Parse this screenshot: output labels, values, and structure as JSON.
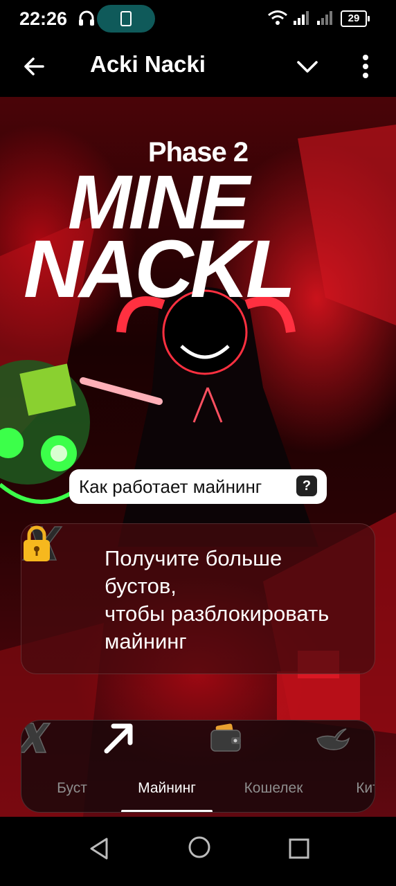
{
  "status_bar": {
    "time": "22:26",
    "battery_level": "29",
    "icons": [
      "headset-icon",
      "phone-icon",
      "wifi-icon",
      "signal-icon",
      "signal-icon",
      "battery-icon"
    ]
  },
  "app_bar": {
    "title": "Acki Nacki",
    "back_icon": "arrow-left-icon",
    "collapse_icon": "chevron-down-icon",
    "menu_icon": "more-vertical-icon"
  },
  "hero": {
    "phase": "Phase 2",
    "title_line_1": "MINE",
    "title_line_2": "NACKL"
  },
  "how_it_works": {
    "label": "Как работает майнинг",
    "help_glyph": "?"
  },
  "lock_card": {
    "message_lines": [
      "Получите больше",
      "бустов,",
      "чтобы разблокировать",
      "майнинг"
    ],
    "icons": [
      "x-logo-icon",
      "lock-icon"
    ]
  },
  "bottom_nav": {
    "active_index": 1,
    "items": [
      {
        "label": "Буст",
        "icon": "x-logo-icon"
      },
      {
        "label": "Майнинг",
        "icon": "arrow-up-right-icon"
      },
      {
        "label": "Кошелек",
        "icon": "wallet-icon"
      },
      {
        "label": "Кит",
        "icon": "whale-icon"
      }
    ]
  },
  "system_nav": {
    "icons": [
      "triangle-back-icon",
      "circle-home-icon",
      "square-recents-icon"
    ]
  },
  "colors": {
    "status_pill": "#0f5a5a",
    "accent_red": "#d4141e",
    "card_bg": "#460a0e",
    "inactive_label": "#8d8d8d"
  }
}
